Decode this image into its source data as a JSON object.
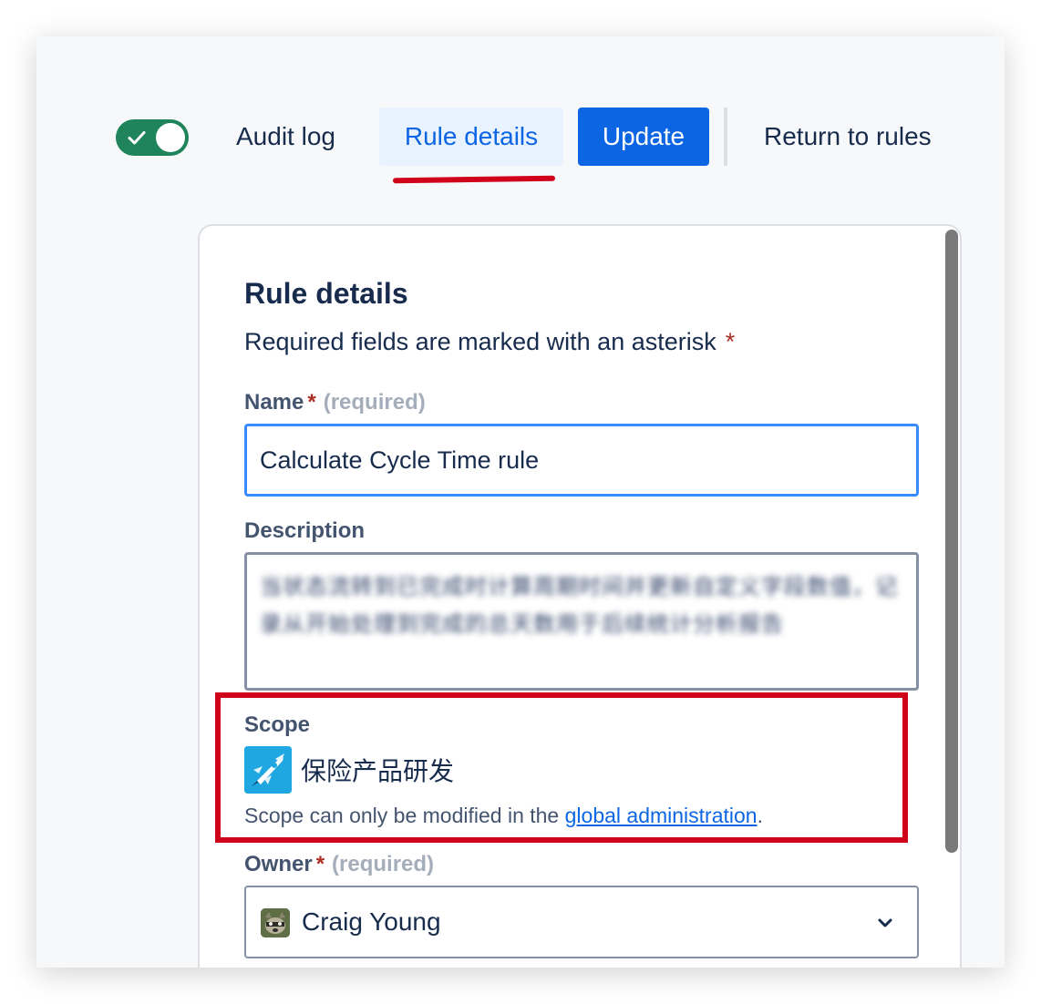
{
  "header": {
    "audit_log_label": "Audit log",
    "rule_details_tab_label": "Rule details",
    "update_label": "Update",
    "return_label": "Return to rules",
    "rule_enabled": true
  },
  "panel": {
    "title": "Rule details",
    "required_note": "Required fields are marked with an asterisk",
    "asterisk": "*",
    "name": {
      "label": "Name",
      "required_text": "(required)",
      "value": "Calculate Cycle Time rule"
    },
    "description": {
      "label": "Description",
      "value": "当状态流转到已完成时计算周期时间并更新自定义字段数值，记录从开始处理到完成的总天数用于后续统计分析报告"
    },
    "scope": {
      "label": "Scope",
      "project_name": "保险产品研发",
      "help_prefix": "Scope can only be modified in the ",
      "help_link": "global administration",
      "help_suffix": "."
    },
    "owner": {
      "label": "Owner",
      "required_text": "(required)",
      "value": "Craig Young"
    }
  },
  "colors": {
    "primary": "#0c66e4",
    "toggle_on": "#1f845a",
    "annotation": "#d0021b",
    "required_star": "#ae2e24"
  }
}
